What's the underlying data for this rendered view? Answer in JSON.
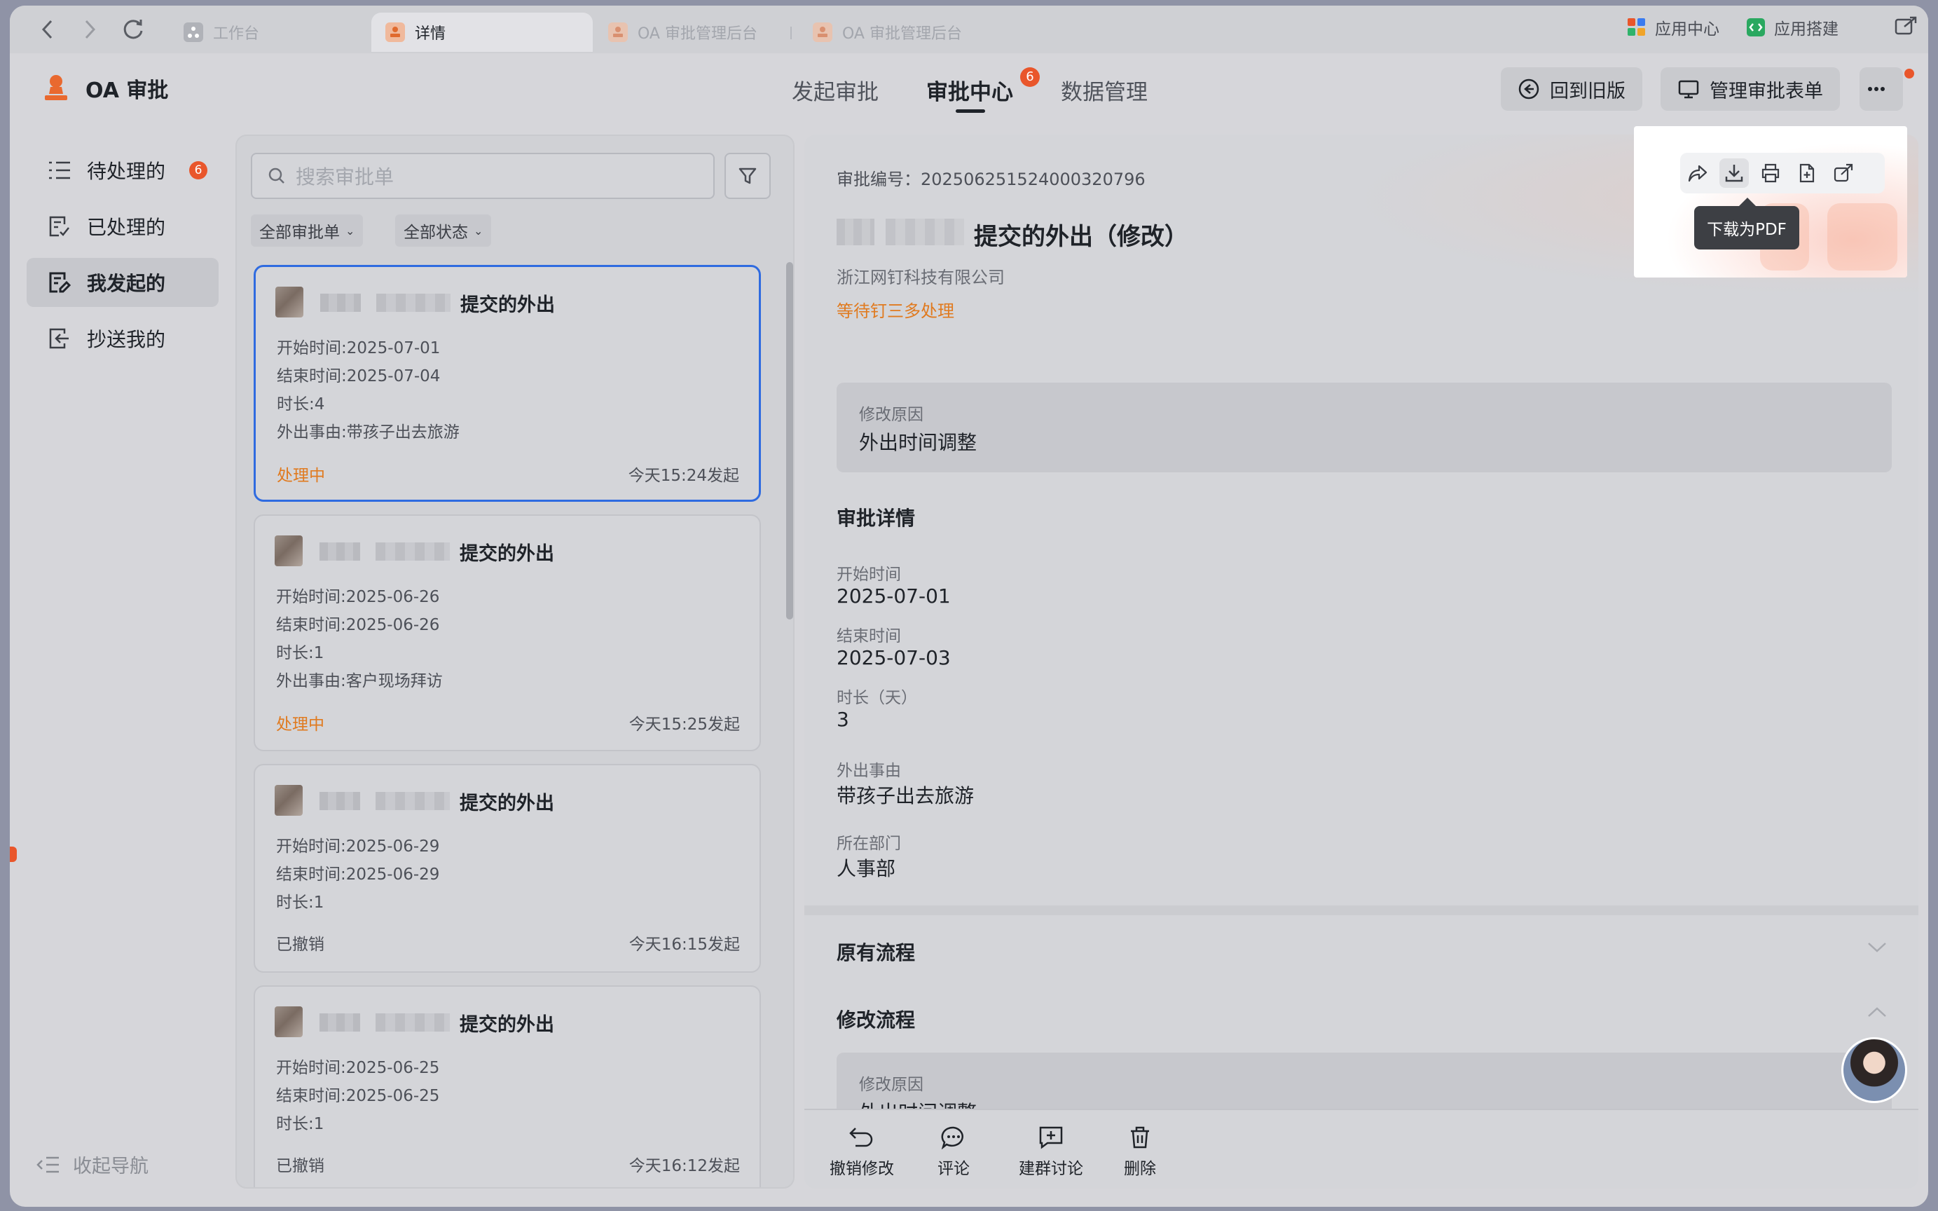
{
  "browser": {
    "tabs": [
      {
        "label": "工作台"
      },
      {
        "label": "详情"
      },
      {
        "label": "OA 审批管理后台"
      },
      {
        "label": "OA 审批管理后台"
      }
    ],
    "app_center": "应用中心",
    "app_builder": "应用搭建"
  },
  "header": {
    "app_name": "OA 审批",
    "nav": [
      "发起审批",
      "审批中心",
      "数据管理"
    ],
    "nav_badge": "6",
    "back_old": "回到旧版",
    "manage_forms": "管理审批表单"
  },
  "sidebar": {
    "items": [
      {
        "label": "待处理的",
        "badge": "6"
      },
      {
        "label": "已处理的"
      },
      {
        "label": "我发起的"
      },
      {
        "label": "抄送我的"
      }
    ],
    "collapse": "收起导航"
  },
  "list": {
    "search_placeholder": "搜索审批单",
    "filter_all_forms": "全部审批单",
    "filter_all_status": "全部状态",
    "cards": [
      {
        "title": "提交的外出",
        "start": "开始时间:2025-07-01",
        "end": "结束时间:2025-07-04",
        "duration": "时长:4",
        "reason": "外出事由:带孩子出去旅游",
        "status": "处理中",
        "time": "今天15:24发起"
      },
      {
        "title": "提交的外出",
        "start": "开始时间:2025-06-26",
        "end": "结束时间:2025-06-26",
        "duration": "时长:1",
        "reason": "外出事由:客户现场拜访",
        "status": "处理中",
        "time": "今天15:25发起"
      },
      {
        "title": "提交的外出",
        "start": "开始时间:2025-06-29",
        "end": "结束时间:2025-06-29",
        "duration": "时长:1",
        "status": "已撤销",
        "time": "今天16:15发起"
      },
      {
        "title": "提交的外出",
        "start": "开始时间:2025-06-25",
        "end": "结束时间:2025-06-25",
        "duration": "时长:1",
        "status": "已撤销",
        "time": "今天16:12发起"
      }
    ]
  },
  "detail": {
    "approval_no": "审批编号：202506251524000320796",
    "title": "提交的外出（修改）",
    "company": "浙江网钉科技有限公司",
    "waiting": "等待钉三多处理",
    "modify_reason_label": "修改原因",
    "modify_reason_value": "外出时间调整",
    "section_details": "审批详情",
    "fields": [
      {
        "label": "开始时间",
        "value": "2025-07-01"
      },
      {
        "label": "结束时间",
        "value": "2025-07-03"
      },
      {
        "label": "时长（天）",
        "value": "3"
      },
      {
        "label": "外出事由",
        "value": "带孩子出去旅游"
      },
      {
        "label": "所在部门",
        "value": "人事部"
      }
    ],
    "section_original": "原有流程",
    "section_modified": "修改流程",
    "modified_reason_label": "修改原因",
    "modified_reason_value": "外出时间调整",
    "actions": [
      "撤销修改",
      "评论",
      "建群讨论",
      "删除"
    ],
    "tooltip": "下载为PDF"
  },
  "colors": {
    "accent_blue": "#2f6be0",
    "status_orange": "#e07a1f",
    "badge_red": "#e9562b"
  }
}
